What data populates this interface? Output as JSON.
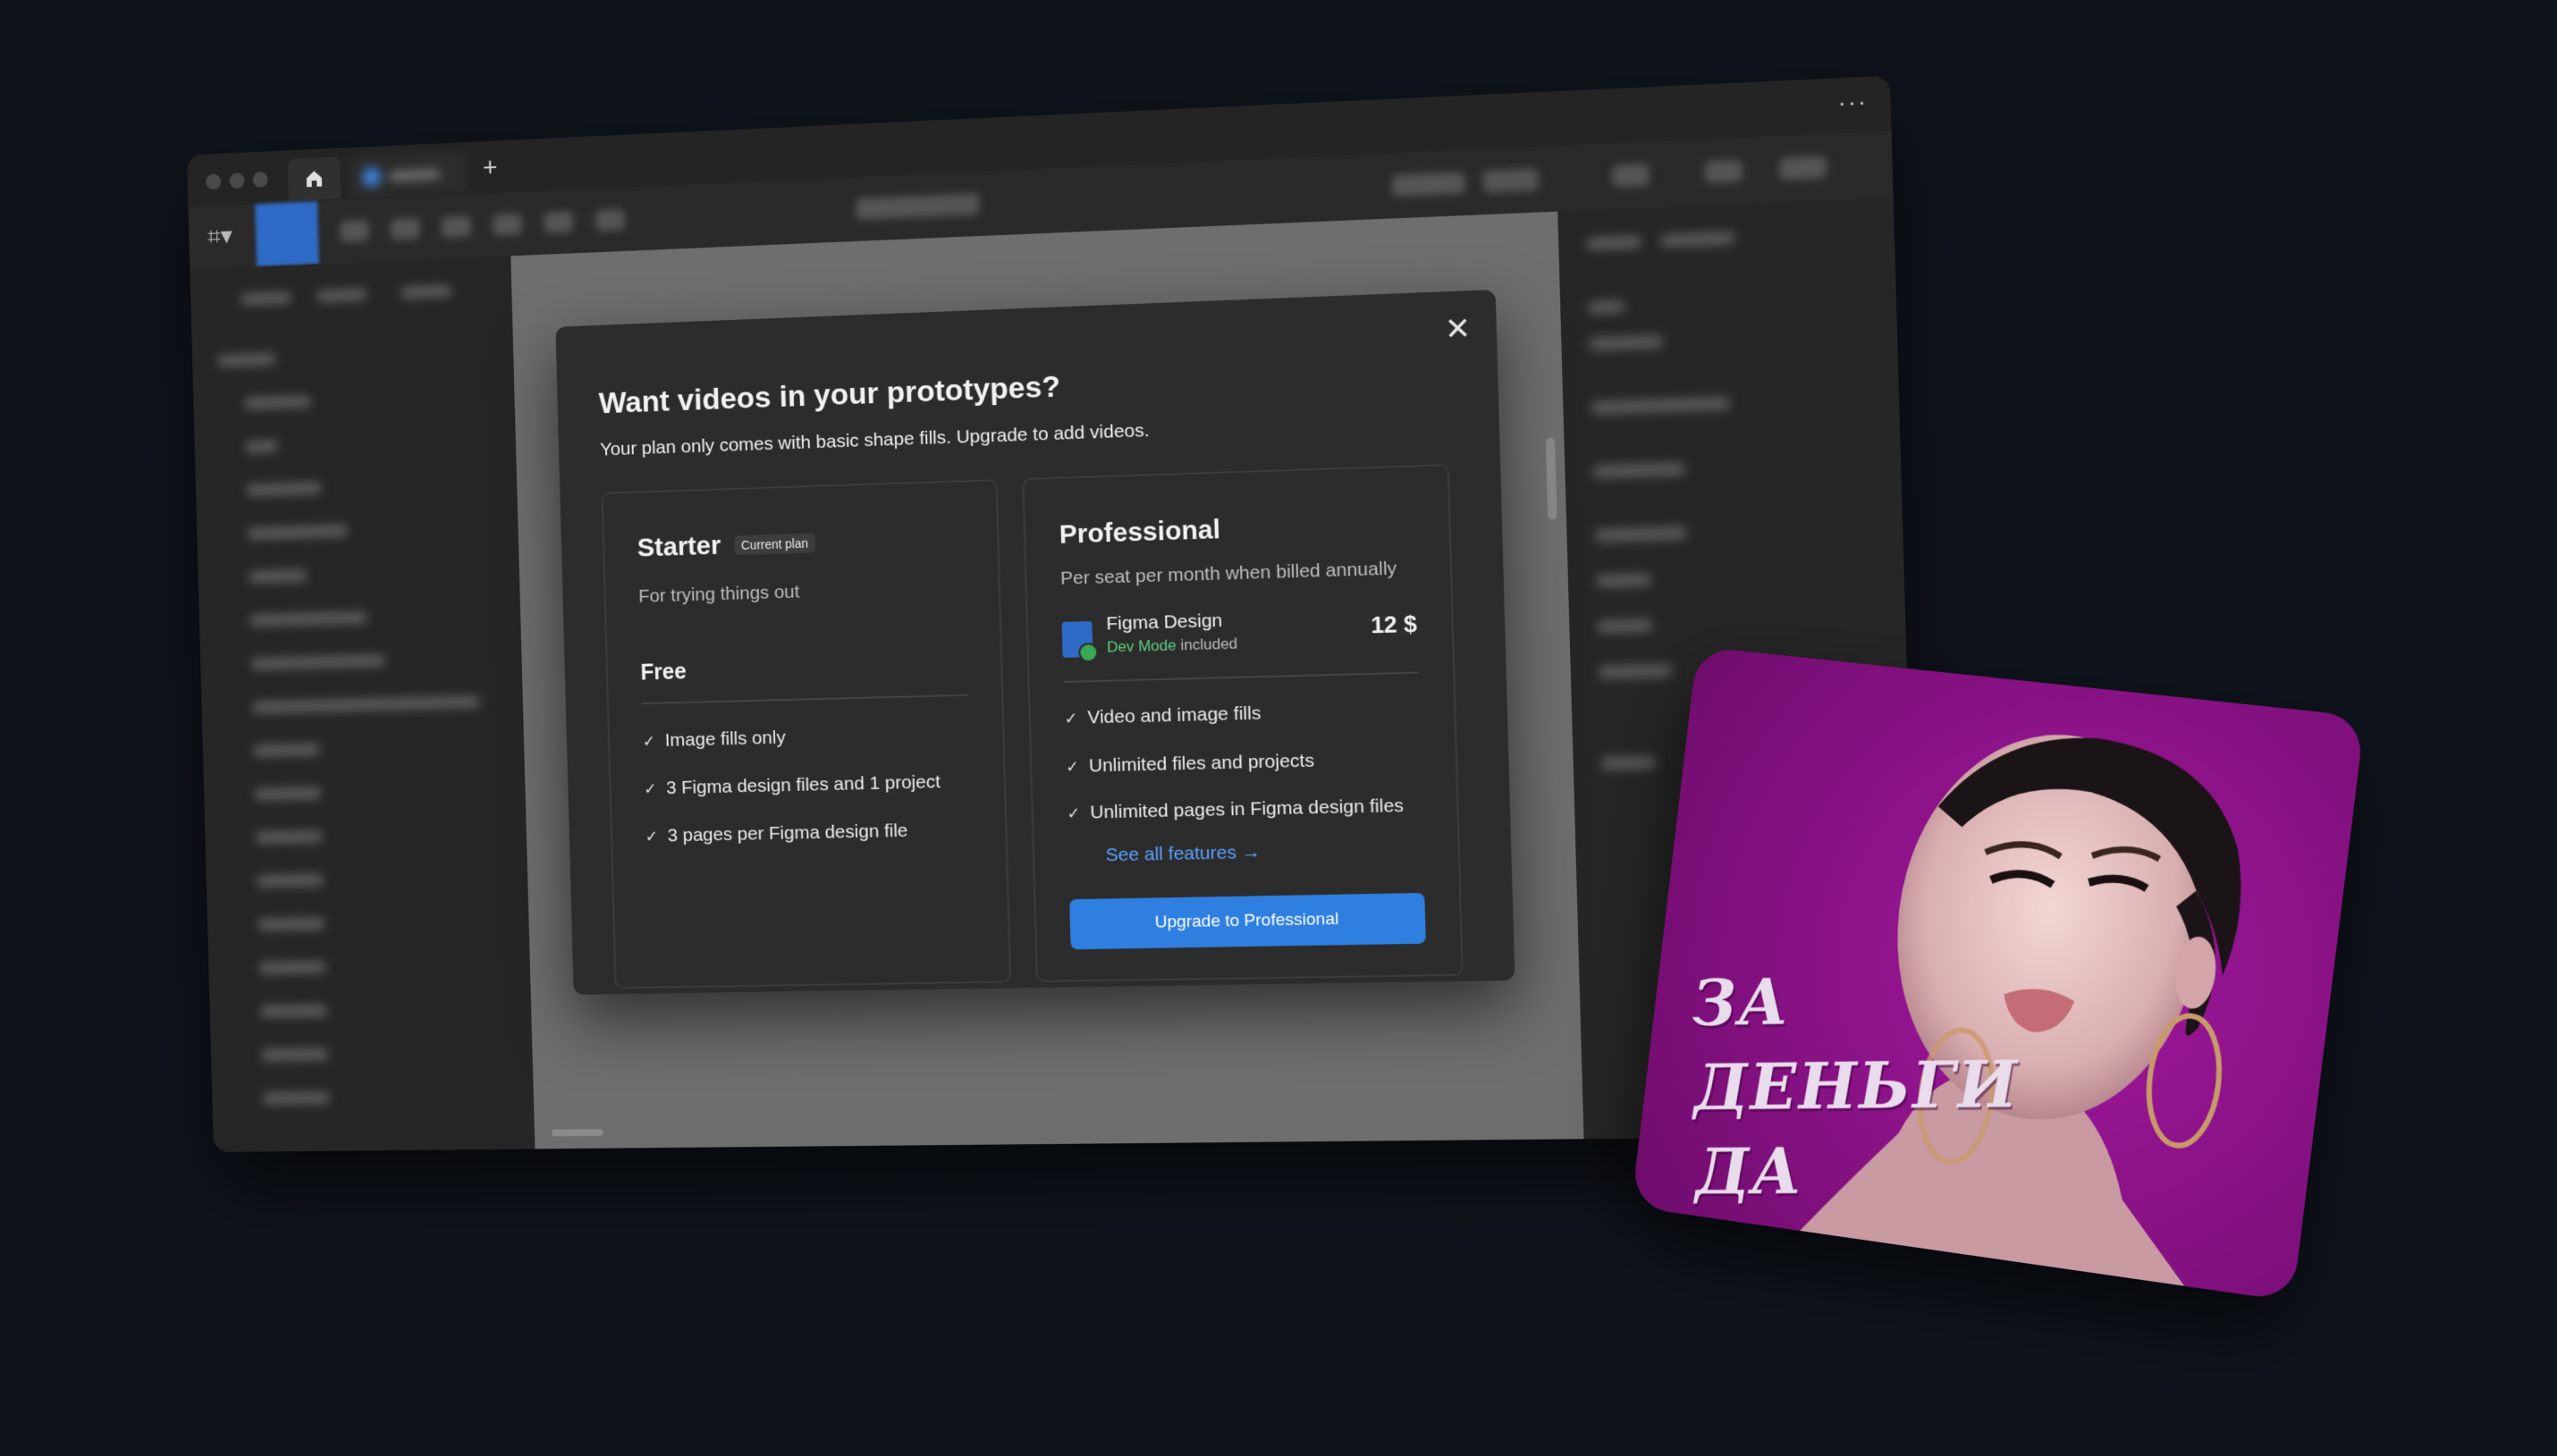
{
  "window": {
    "tabs": {
      "plus": "+"
    },
    "more": "···"
  },
  "modal": {
    "title": "Want videos in your prototypes?",
    "subtitle": "Your plan only comes with basic shape fills. Upgrade to add videos.",
    "close_icon": "close-icon",
    "starter": {
      "name": "Starter",
      "badge": "Current plan",
      "description": "For trying things out",
      "tier": "Free",
      "features": [
        "Image fills only",
        "3 Figma design files and 1 project",
        "3 pages per Figma design file"
      ]
    },
    "professional": {
      "name": "Professional",
      "description": "Per seat per month when billed annually",
      "product_name": "Figma Design",
      "dev_mode": "Dev Mode",
      "dev_included": "included",
      "price": "12 $",
      "features": [
        "Video and image fills",
        "Unlimited files and projects",
        "Unlimited pages in Figma design files"
      ],
      "see_all": "See all features →",
      "cta": "Upgrade to Professional"
    }
  },
  "photo": {
    "caption_lines": [
      "ЗА",
      "ДЕНЬГИ",
      "ДА"
    ]
  },
  "colors": {
    "accent": "#2f7fe0",
    "link": "#5aa0ff",
    "dev_green": "#5fce7e",
    "photo_bg": "#8c1388"
  }
}
